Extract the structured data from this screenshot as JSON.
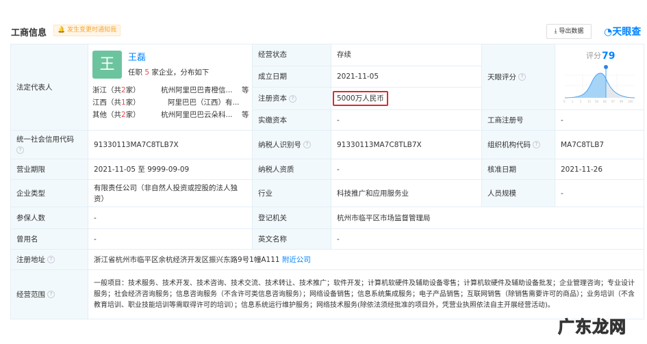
{
  "header": {
    "title": "工商信息",
    "notify_label": "发生变更时通知我",
    "export_label": "导出数据",
    "logo": "天眼查"
  },
  "legal_rep": {
    "label": "法定代表人",
    "avatar_char": "王",
    "name": "王磊",
    "sub_prefix": "任职",
    "count": "5",
    "sub_suffix": "家企业，分布如下",
    "regions": [
      {
        "region": "浙江（共",
        "n": "2",
        "end": "家）",
        "company": "杭州阿里巴巴青橙信...",
        "more": "等"
      },
      {
        "region": "江西（共",
        "n": "1",
        "end": "家）",
        "company": "阿里巴巴（江西）有...",
        "more": ""
      },
      {
        "region": "其他（共",
        "n": "2",
        "end": "家）",
        "company": "杭州阿里巴巴云朵科...",
        "more": "等"
      }
    ]
  },
  "status": {
    "label": "经营状态",
    "value": "存续"
  },
  "founded": {
    "label": "成立日期",
    "value": "2021-11-05"
  },
  "capital": {
    "label": "注册资本",
    "value": "5000万人民币"
  },
  "paid_capital": {
    "label": "实缴资本",
    "value": "-"
  },
  "score": {
    "label": "天眼评分",
    "score_label": "评分",
    "score": "79",
    "ticks": [
      "0",
      "1",
      "5",
      "15",
      "50",
      "85",
      "97",
      "99",
      "100"
    ]
  },
  "reg_no": {
    "label": "工商注册号",
    "value": "-"
  },
  "credit_code": {
    "label": "统一社会信用代码",
    "value": "91330113MA7C8TLB7X"
  },
  "tax_id": {
    "label": "纳税人识别号",
    "value": "91330113MA7C8TLB7X"
  },
  "org_code": {
    "label": "组织机构代码",
    "value": "MA7C8TLB7"
  },
  "term": {
    "label": "营业期限",
    "value": "2021-11-05 至 9999-09-09"
  },
  "tax_qual": {
    "label": "纳税人资质",
    "value": "-"
  },
  "approved": {
    "label": "核准日期",
    "value": "2021-11-26"
  },
  "type": {
    "label": "企业类型",
    "value": "有限责任公司（非自然人投资或控股的法人独资）"
  },
  "industry": {
    "label": "行业",
    "value": "科技推广和应用服务业"
  },
  "staff": {
    "label": "人员规模",
    "value": "-"
  },
  "insured": {
    "label": "参保人数",
    "value": "-"
  },
  "authority": {
    "label": "登记机关",
    "value": "杭州市临平区市场监督管理局"
  },
  "former": {
    "label": "曾用名",
    "value": "-"
  },
  "english": {
    "label": "英文名称",
    "value": "-"
  },
  "address": {
    "label": "注册地址",
    "value": "浙江省杭州市临平区余杭经济开发区振兴东路9号1幢A111",
    "nearby": "附近公司"
  },
  "scope": {
    "label": "经营范围",
    "value": "一般项目：技术服务、技术开发、技术咨询、技术交流、技术转让、技术推广；软件开发；计算机软硬件及辅助设备零售；计算机软硬件及辅助设备批发；企业管理咨询；专业设计服务；社会经济咨询服务；信息咨询服务（不含许可类信息咨询服务）；网络设备销售；信息系统集成服务；电子产品销售；互联网销售（除销售需要许可的商品）；业务培训（不含教育培训、职业技能培训等需取得许可的培训）；信息系统运行维护服务；网络技术服务(除依法须经批准的项目外，凭营业执照依法自主开展经营活动)。"
  },
  "watermark": "广东龙网"
}
